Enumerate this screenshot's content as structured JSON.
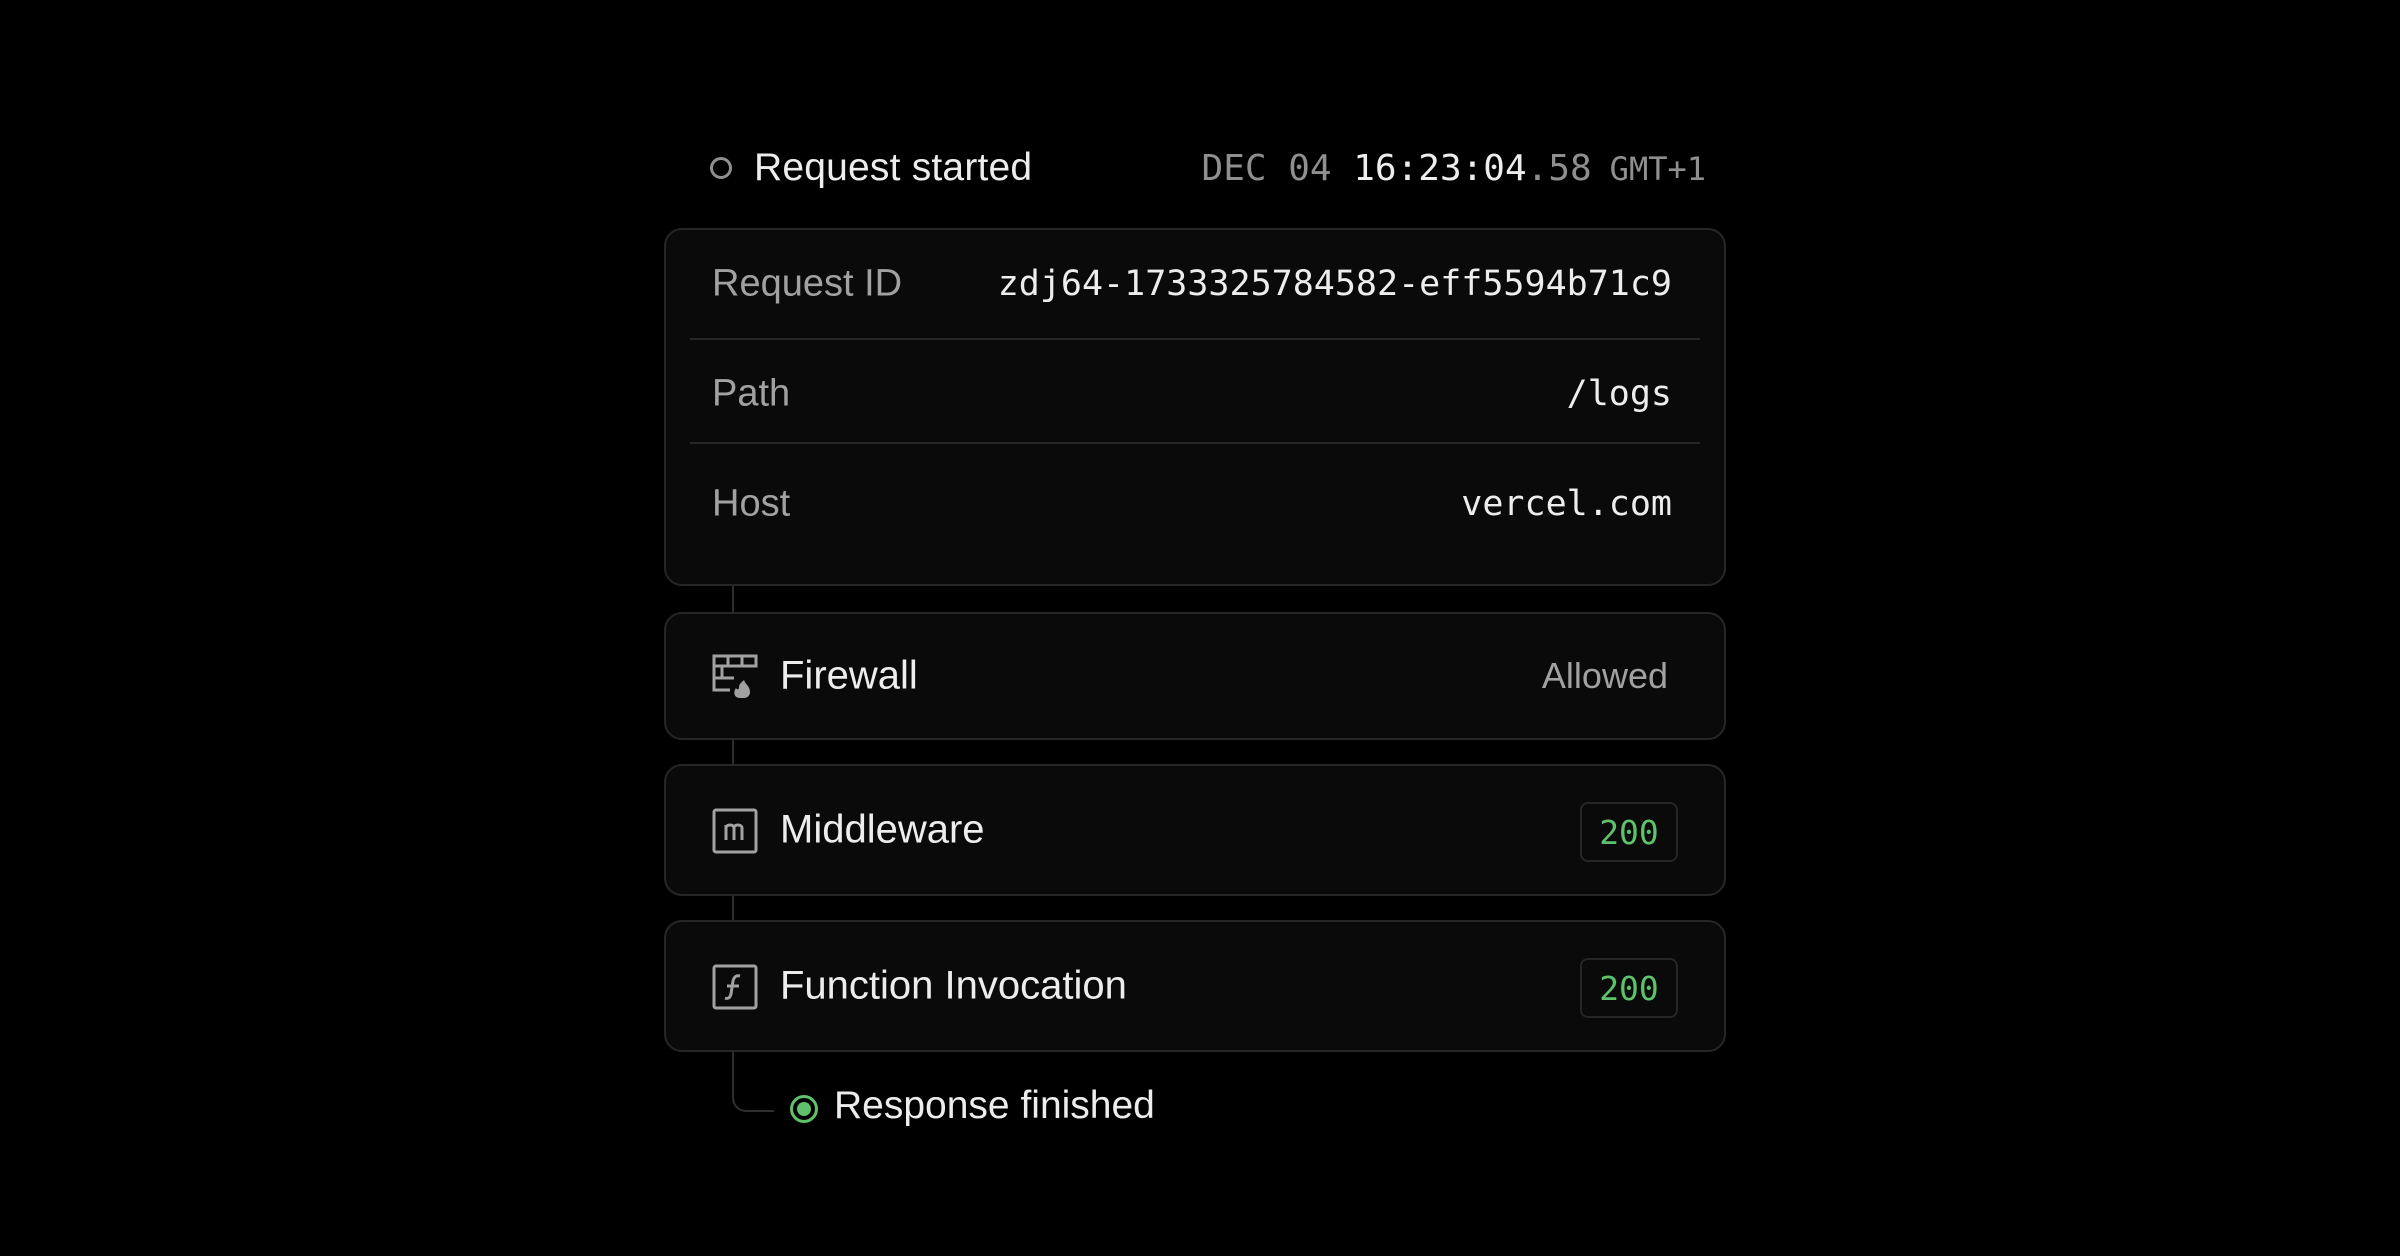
{
  "header": {
    "title": "Request started",
    "date": "DEC 04",
    "time": "16:23:04",
    "fraction": ".58",
    "timezone": "GMT+1"
  },
  "details": [
    {
      "label": "Request ID",
      "value": "zdj64-1733325784582-eff5594b71c9"
    },
    {
      "label": "Path",
      "value": "/logs"
    },
    {
      "label": "Host",
      "value": "vercel.com"
    }
  ],
  "steps": [
    {
      "label": "Firewall",
      "icon": "firewall-icon",
      "status": "Allowed"
    },
    {
      "label": "Middleware",
      "icon": "middleware-icon",
      "status_code": "200"
    },
    {
      "label": "Function Invocation",
      "icon": "function-icon",
      "status_code": "200"
    }
  ],
  "footer": {
    "title": "Response finished"
  },
  "colors": {
    "background": "#000000",
    "card": "#0a0a0a",
    "border": "#262626",
    "success": "#5fc16b",
    "muted": "#a1a1a1",
    "text": "#ededed"
  }
}
